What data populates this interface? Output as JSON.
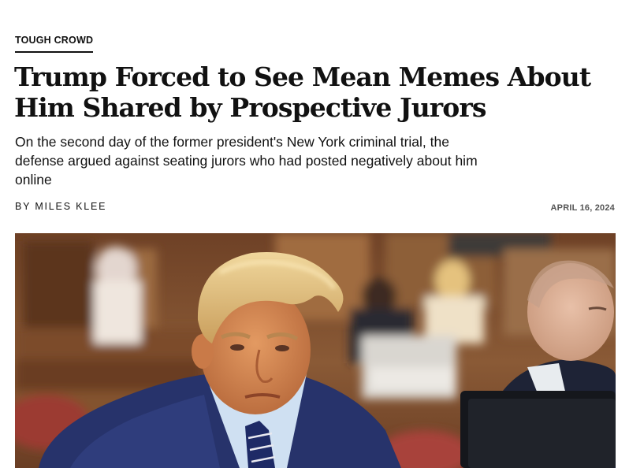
{
  "article": {
    "kicker": "TOUGH CROWD",
    "headline": "Trump Forced to See Mean Memes About Him Shared by Prospective Jurors",
    "dek": "On the second day of the former president's New York criminal trial, the defense argued against seating jurors who had posted negatively about him online",
    "byline": "BY MILES KLEE",
    "date": "APRIL 16, 2024"
  },
  "colors": {
    "text": "#111111",
    "date": "#555555",
    "courtroom_wood": "#7a4a2a",
    "suit_navy": "#27336b"
  }
}
